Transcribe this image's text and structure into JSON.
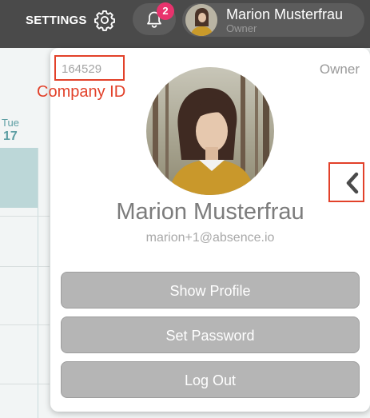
{
  "header": {
    "settings_label": "SETTINGS",
    "notifications_count": "2",
    "user_name": "Marion Musterfrau",
    "user_role": "Owner"
  },
  "calendar": {
    "day_of_week": "Tue",
    "day_number": "17"
  },
  "profile": {
    "company_id": "164529",
    "role": "Owner",
    "name": "Marion Musterfrau",
    "email": "marion+1@absence.io"
  },
  "actions": {
    "show_profile": "Show Profile",
    "set_password": "Set Password",
    "log_out": "Log Out"
  },
  "annotations": {
    "company_id_label": "Company ID"
  },
  "colors": {
    "topbar": "#4a4a4a",
    "badge": "#e8336d",
    "button": "#b5b5b5",
    "annotation": "#e2412a",
    "calendar_accent": "#5d9ea3"
  },
  "icons": [
    "gear-icon",
    "bell-icon",
    "chevron-left-icon"
  ]
}
